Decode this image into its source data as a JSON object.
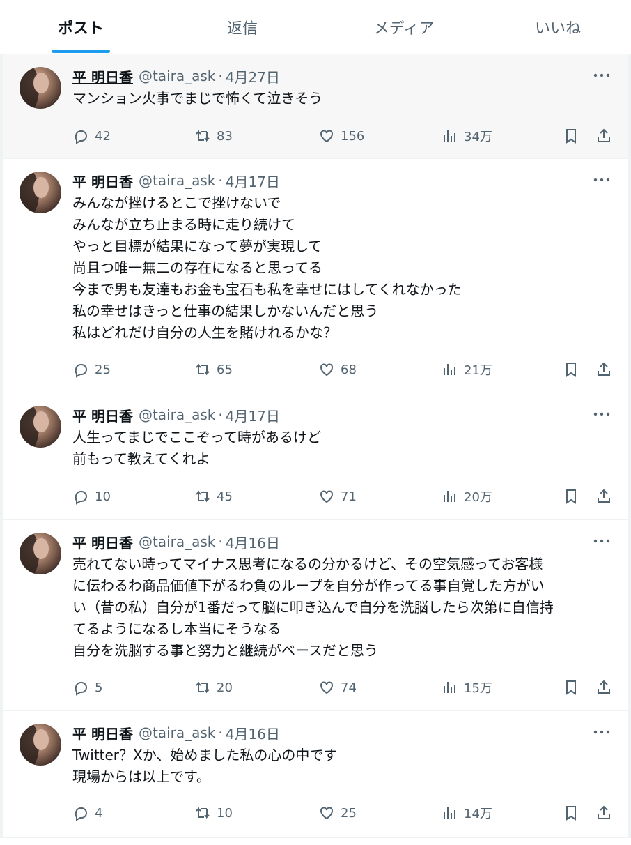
{
  "tabs": [
    {
      "label": "ポスト",
      "active": true
    },
    {
      "label": "返信",
      "active": false
    },
    {
      "label": "メディア",
      "active": false
    },
    {
      "label": "いいね",
      "active": false
    }
  ],
  "posts": [
    {
      "name": "平 明日香",
      "handle": "@taira_ask",
      "sep": "·",
      "date": "4月27日",
      "text": "マンション火事でまじで怖くて泣きそう",
      "replies": "42",
      "reposts": "83",
      "likes": "156",
      "views": "34万"
    },
    {
      "name": "平 明日香",
      "handle": "@taira_ask",
      "sep": "·",
      "date": "4月17日",
      "text": "みんなが挫けるとこで挫けないで\nみんなが立ち止まる時に走り続けて\nやっと目標が結果になって夢が実現して\n尚且つ唯一無二の存在になると思ってる\n今まで男も友達もお金も宝石も私を幸せにはしてくれなかった\n私の幸せはきっと仕事の結果しかないんだと思う\n私はどれだけ自分の人生を賭けれるかな？",
      "replies": "25",
      "reposts": "65",
      "likes": "68",
      "views": "21万"
    },
    {
      "name": "平 明日香",
      "handle": "@taira_ask",
      "sep": "·",
      "date": "4月17日",
      "text": "人生ってまじでここぞって時があるけど\n前もって教えてくれよ",
      "replies": "10",
      "reposts": "45",
      "likes": "71",
      "views": "20万"
    },
    {
      "name": "平 明日香",
      "handle": "@taira_ask",
      "sep": "·",
      "date": "4月16日",
      "text": "売れてない時ってマイナス思考になるの分かるけど、その空気感ってお客様\nに伝わるわ商品価値下がるわ負のループを自分が作ってる事自覚した方がい\nい（昔の私）自分が1番だって脳に叩き込んで自分を洗脳したら次第に自信持\nてるようになるし本当にそうなる\n自分を洗脳する事と努力と継続がベースだと思う",
      "replies": "5",
      "reposts": "20",
      "likes": "74",
      "views": "15万"
    },
    {
      "name": "平 明日香",
      "handle": "@taira_ask",
      "sep": "·",
      "date": "4月16日",
      "text": "Twitter？Xか、始めました私の心の中です\n現場からは以上です。",
      "replies": "4",
      "reposts": "10",
      "likes": "25",
      "views": "14万"
    }
  ]
}
